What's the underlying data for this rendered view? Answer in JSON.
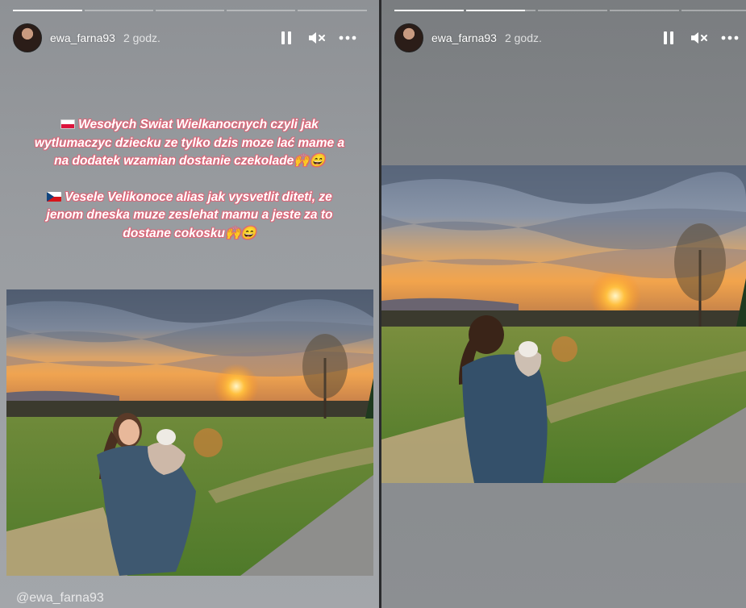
{
  "left_story": {
    "username": "ewa_farna93",
    "time": "2 godz.",
    "progress": [
      1,
      0,
      0,
      0,
      0
    ],
    "caption": {
      "pl_line1": "Wesołych Swiat Wielkanocnych czyli jak",
      "pl_line2": "wytlumaczyc dziecku ze tylko dzis moze lać mame a",
      "pl_line3": "na dodatek wzamian dostanie czekolade🙌😄",
      "cz_line1": "Vesele Velikonoce alias jak vysvetlit diteti, ze",
      "cz_line2": "jenom dneska muze zeslehat mamu a jeste za to",
      "cz_line3": "dostane cokosku🙌😄"
    },
    "mention": "@ewa_farna93"
  },
  "right_story": {
    "username": "ewa_farna93",
    "time": "2 godz.",
    "progress": [
      1,
      0.85,
      0,
      0,
      0
    ]
  },
  "icons": {
    "pause": "pause-icon",
    "mute": "speaker-muted-icon",
    "more": "more-options-icon"
  },
  "colors": {
    "caption_outline": "#d9687a",
    "progress_active": "#ffffff"
  }
}
